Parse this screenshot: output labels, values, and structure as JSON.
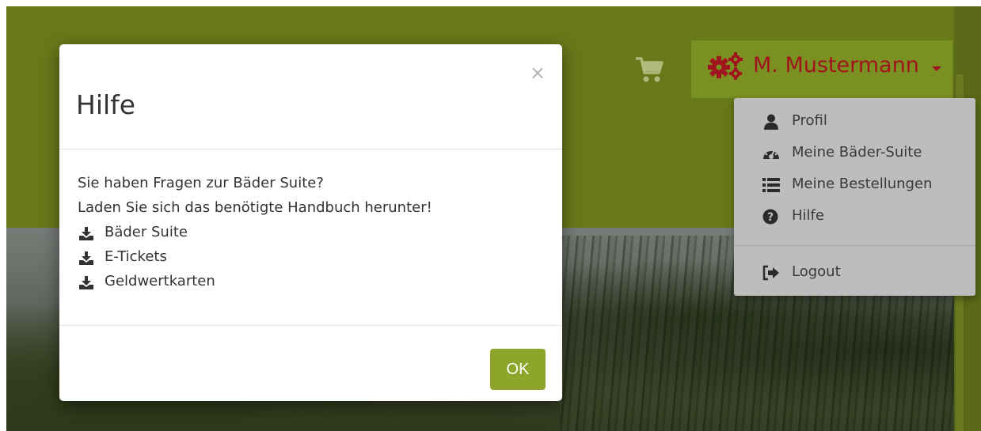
{
  "header": {
    "cart_icon": "shopping-cart-icon",
    "user_icon": "gears-icon",
    "user_name": "M. Mustermann",
    "brand_color": "#859c22",
    "accent_color": "#a0141e"
  },
  "dropdown": {
    "items": [
      {
        "label": "Profil",
        "icon": "user-icon"
      },
      {
        "label": "Meine Bäder-Suite",
        "icon": "dashboard-icon"
      },
      {
        "label": "Meine Bestellungen",
        "icon": "list-icon"
      },
      {
        "label": "Hilfe",
        "icon": "question-circle-icon"
      },
      {
        "label": "Logout",
        "icon": "sign-out-icon"
      }
    ]
  },
  "modal": {
    "title": "Hilfe",
    "close_glyph": "×",
    "intro_line_1": "Sie haben Fragen zur Bäder Suite?",
    "intro_line_2": "Laden Sie sich das benötigte Handbuch herunter!",
    "downloads": [
      {
        "label": "Bäder Suite",
        "icon": "download-icon"
      },
      {
        "label": "E-Tickets",
        "icon": "download-icon"
      },
      {
        "label": "Geldwertkarten",
        "icon": "download-icon"
      }
    ],
    "ok_label": "OK",
    "ok_color": "#8ca52a"
  }
}
